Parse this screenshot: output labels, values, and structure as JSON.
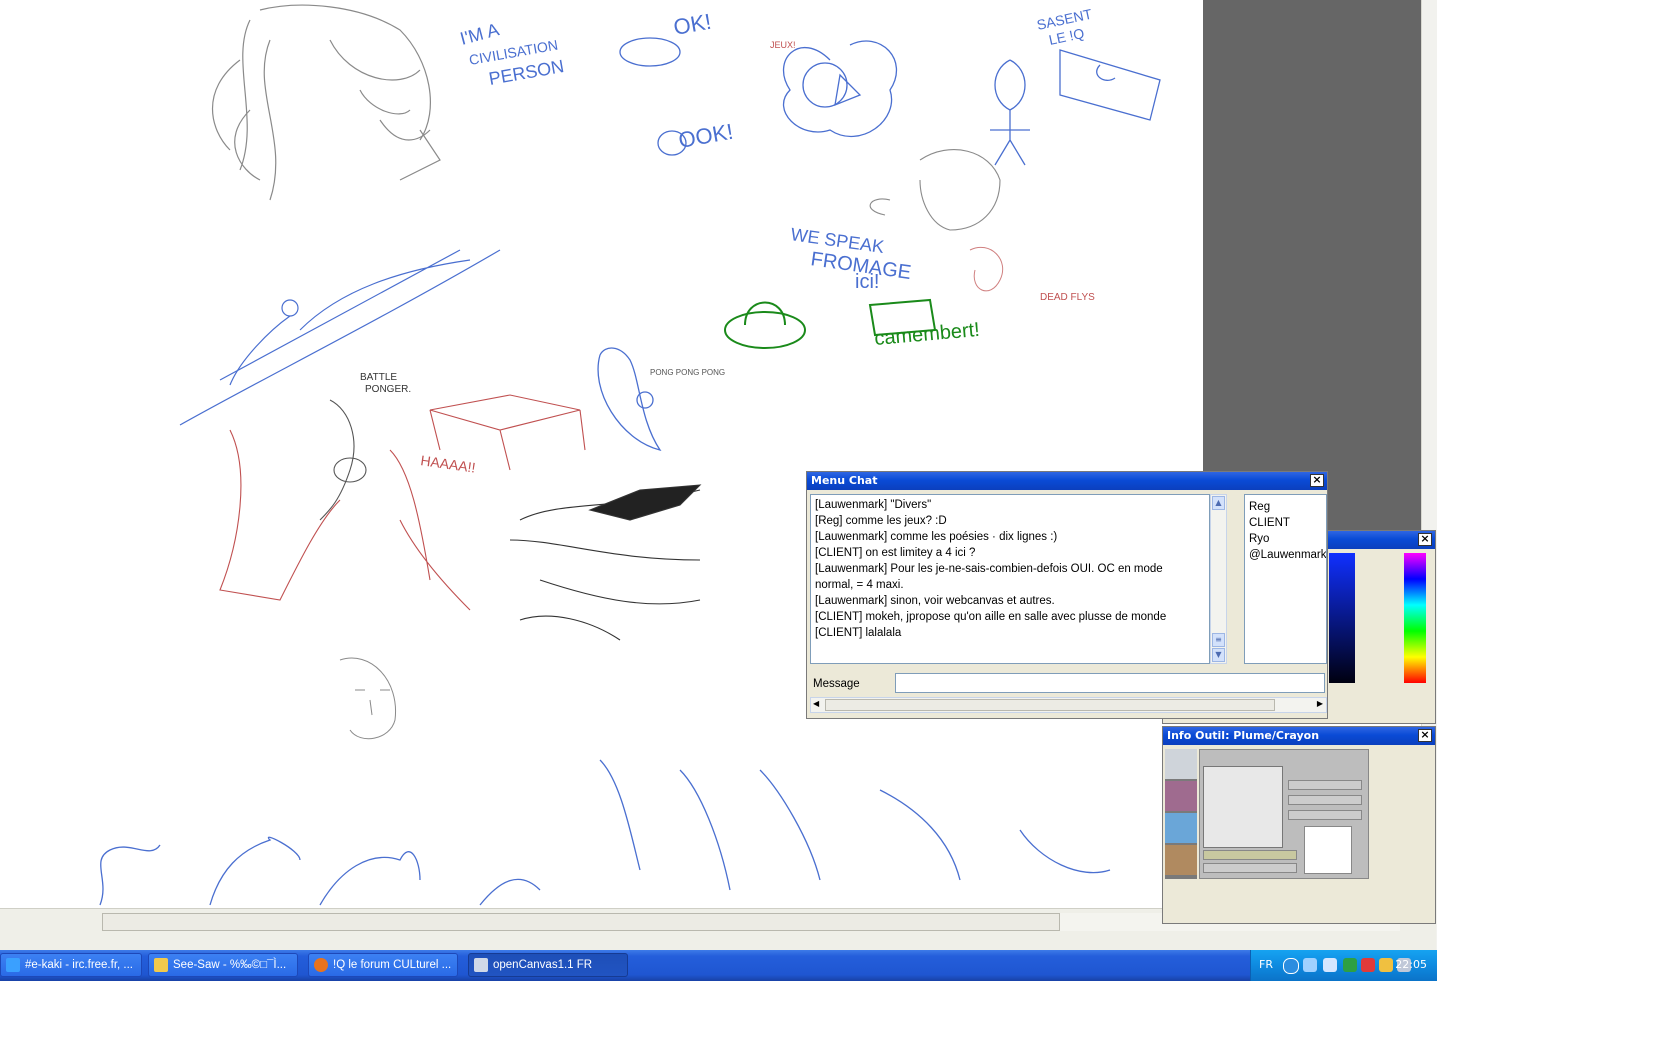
{
  "canvas": {
    "doodle_texts": [
      "I'M A",
      "CIVILISATION",
      "PERSON",
      "OK!",
      "JEUX!",
      "OOK!",
      "SASENT",
      "LE !Q",
      "WE SPEAK",
      "FROMAGE",
      "ici!",
      "camembert!",
      "BATTLE",
      "PONGER.",
      "HAAAA!!",
      "PONG PONG PONG",
      "DEAD FLYS"
    ]
  },
  "chat": {
    "title": "Menu Chat",
    "messages": [
      "[Lauwenmark] \"Divers\"",
      "[Reg] comme les jeux? :D",
      "[Lauwenmark] comme les poésies · dix lignes :)",
      "[CLIENT] on est limitey a 4 ici ?",
      "[Lauwenmark] Pour les je-ne-sais-combien-defois OUI. OC en mode",
      "normal, = 4 maxi.",
      "[Lauwenmark] sinon, voir webcanvas et autres.",
      "[CLIENT] mokeh, jpropose qu'on aille en salle avec plusse de monde",
      "[CLIENT] lalalala"
    ],
    "users": [
      "Reg",
      "CLIENT",
      "Ryo",
      "@Lauwenmark"
    ],
    "message_label": "Message",
    "message_value": ""
  },
  "tool_panel": {
    "title": "Info Outil: Plume/Crayon"
  },
  "taskbar": {
    "buttons": [
      {
        "label": "#e-kaki - irc.free.fr, ...",
        "icon_color": "#3aa0ff",
        "active": false
      },
      {
        "label": "See-Saw - %‰©□¯Ì...",
        "icon_color": "#f2c94c",
        "active": false
      },
      {
        "label": "!Q le forum CULturel ...",
        "icon_color": "#e8731d",
        "active": false
      },
      {
        "label": "openCanvas1.1 FR",
        "icon_color": "#cfd8e8",
        "active": true
      }
    ],
    "tray_language": "FR",
    "clock": "22:05"
  },
  "colors": {
    "titlebar": "#0a4bd6",
    "taskbar": "#245edb",
    "workspace_gray": "#666666",
    "sketch_blue": "#4a6fd0",
    "sketch_red": "#c05050",
    "sketch_green": "#1a8a1a"
  }
}
